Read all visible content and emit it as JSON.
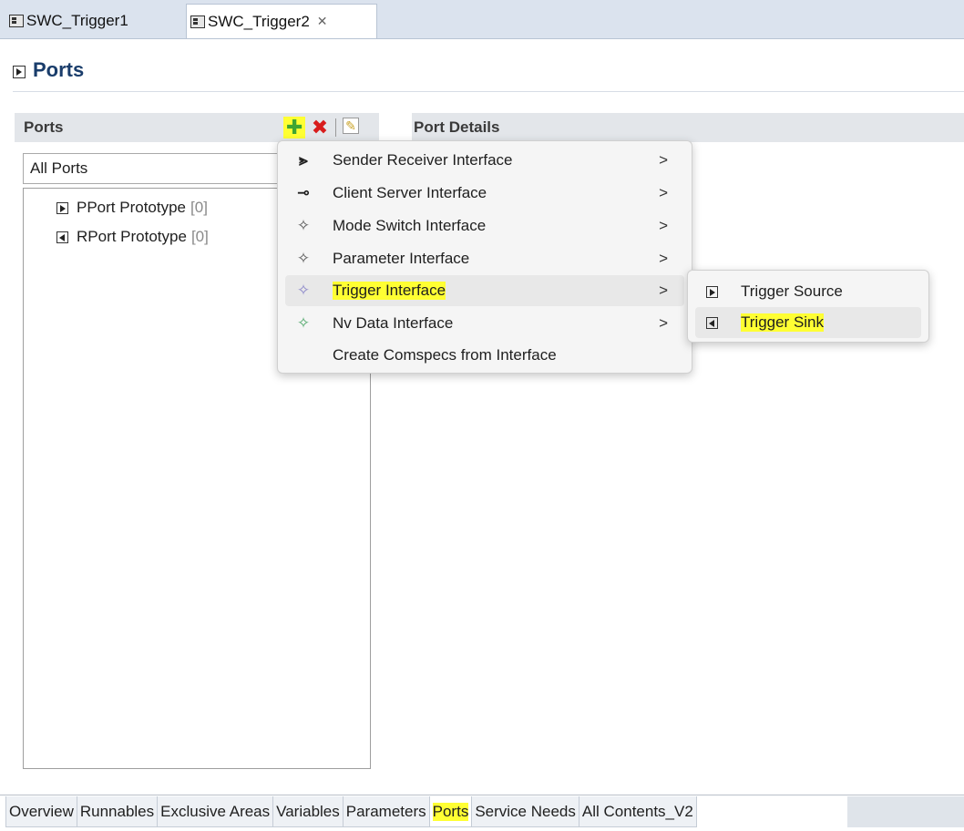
{
  "editor_tabs": [
    {
      "label": "SWC_Trigger1"
    },
    {
      "label": "SWC_Trigger2",
      "close_glyph": "✕"
    }
  ],
  "page": {
    "title": "Ports"
  },
  "ports_section": {
    "title": "Ports",
    "filter_value": "All Ports",
    "tree": [
      {
        "label": "PPort Prototype",
        "count": "[0]"
      },
      {
        "label": "RPort Prototype",
        "count": "[0]"
      }
    ]
  },
  "details_section": {
    "title": "Port Details"
  },
  "context_menu": {
    "items": [
      {
        "label": "Sender Receiver Interface",
        "icon": "sender-receiver-icon",
        "arrow": ">"
      },
      {
        "label": "Client Server Interface",
        "icon": "client-server-icon",
        "arrow": ">"
      },
      {
        "label": "Mode Switch Interface",
        "icon": "mode-switch-icon",
        "arrow": ">"
      },
      {
        "label": "Parameter Interface",
        "icon": "parameter-icon",
        "arrow": ">"
      },
      {
        "label": "Trigger Interface",
        "icon": "trigger-icon",
        "arrow": ">",
        "highlighted": true
      },
      {
        "label": "Nv Data Interface",
        "icon": "nv-data-icon",
        "arrow": ">"
      },
      {
        "label": "Create Comspecs from Interface"
      }
    ]
  },
  "submenu": {
    "items": [
      {
        "label": "Trigger Source",
        "icon": "trigger-source-icon"
      },
      {
        "label": "Trigger Sink",
        "icon": "trigger-sink-icon",
        "highlighted": true
      }
    ]
  },
  "bottom_tabs": [
    {
      "label": "Overview"
    },
    {
      "label": "Runnables"
    },
    {
      "label": "Exclusive Areas"
    },
    {
      "label": "Variables"
    },
    {
      "label": "Parameters"
    },
    {
      "label": "Ports",
      "active": true
    },
    {
      "label": "Service Needs"
    },
    {
      "label": "All Contents_V2"
    }
  ],
  "colors": {
    "highlight": "#ffff33",
    "title_blue": "#1a3d6b",
    "add_green": "#3fa532",
    "delete_red": "#d81c1c"
  }
}
